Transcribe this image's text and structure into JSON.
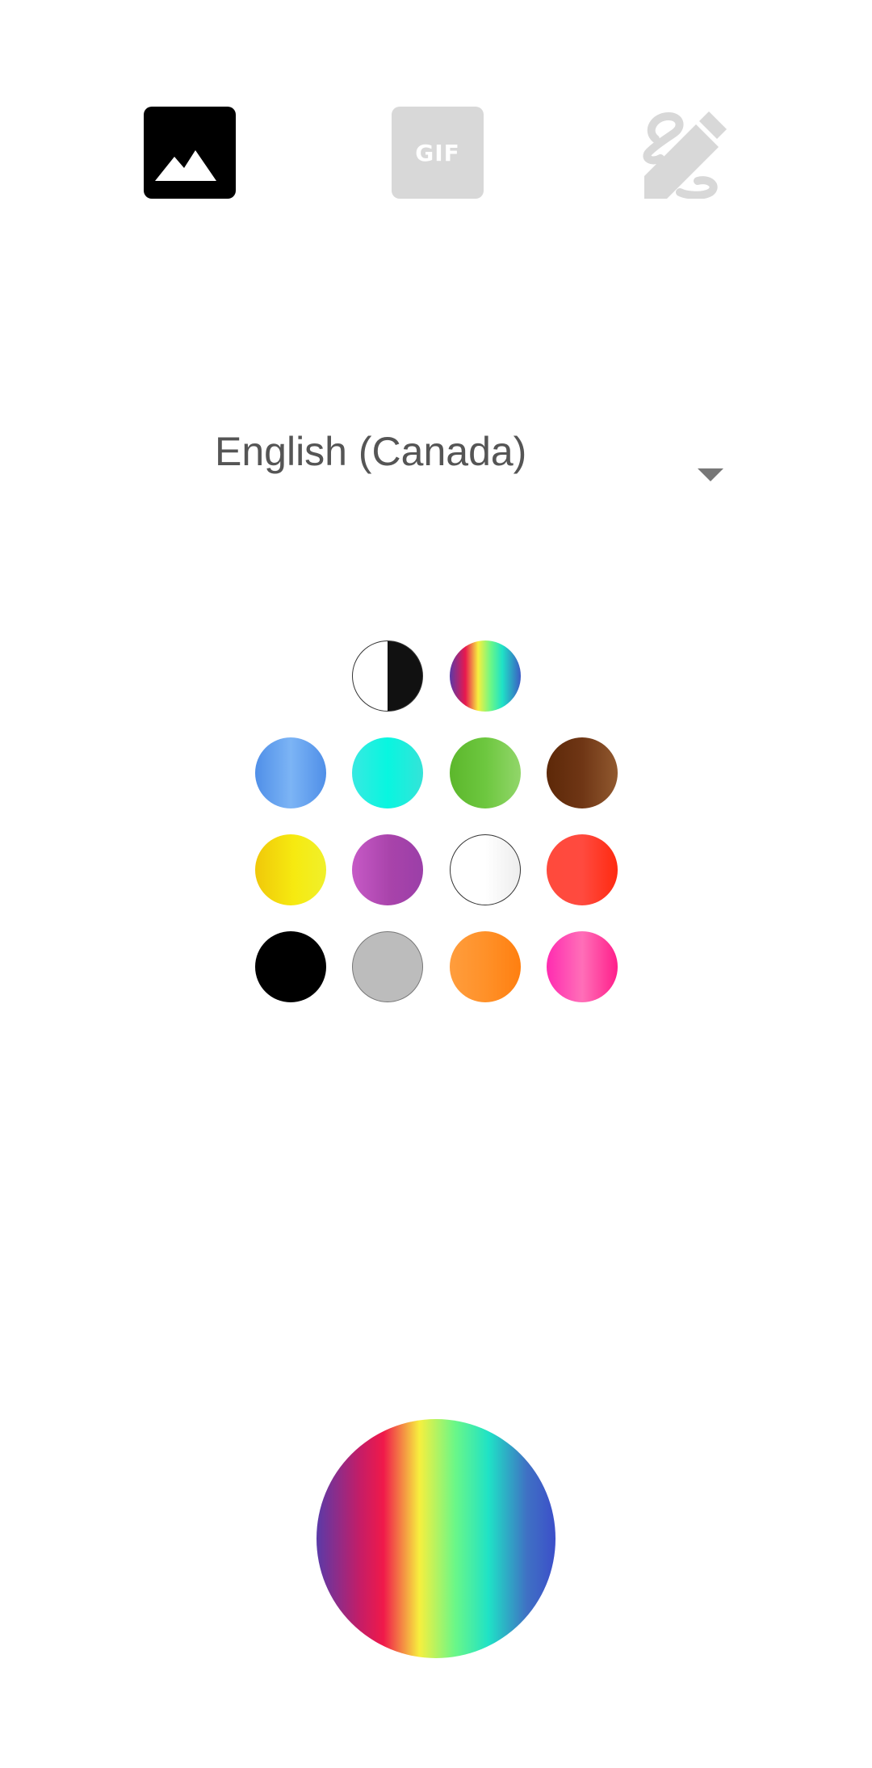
{
  "modes": [
    {
      "name": "image",
      "icon": "image-icon",
      "active": true
    },
    {
      "name": "gif",
      "icon": "gif-icon",
      "label": "GIF",
      "active": false
    },
    {
      "name": "draw",
      "icon": "draw-icon",
      "active": false
    }
  ],
  "language": {
    "selected": "English (Canada)"
  },
  "colors": {
    "active": "#000000",
    "inactive": "#d8d8d8",
    "swatches": [
      {
        "id": "contrast",
        "icon": "contrast-icon"
      },
      {
        "id": "rainbow",
        "icon": "rainbow-icon"
      },
      {
        "id": "blue",
        "color": "#5b9cf0"
      },
      {
        "id": "cyan",
        "color": "#1ef0e0"
      },
      {
        "id": "green",
        "color": "#6cc73e"
      },
      {
        "id": "brown",
        "color": "#6e3414"
      },
      {
        "id": "yellow",
        "color": "#f6e10c"
      },
      {
        "id": "purple",
        "color": "#b14fbf"
      },
      {
        "id": "white",
        "color": "#ffffff"
      },
      {
        "id": "red",
        "color": "#fe3a2c"
      },
      {
        "id": "black",
        "color": "#000000"
      },
      {
        "id": "gray",
        "color": "#bcbcbc"
      },
      {
        "id": "orange",
        "color": "#fe9432"
      },
      {
        "id": "pink",
        "color": "#ff3b9e"
      }
    ],
    "preview": "rainbow"
  }
}
